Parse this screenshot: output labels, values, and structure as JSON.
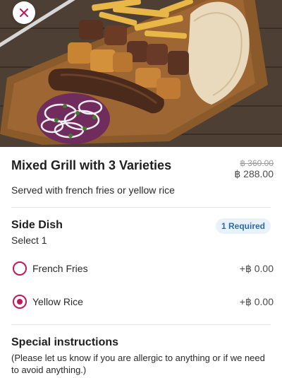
{
  "header": {
    "image_name": "mixed-grill-photo",
    "close_icon": "close-icon",
    "accent": "#c2185b"
  },
  "item": {
    "title": "Mixed Grill with 3 Varieties",
    "original_price": "฿ 360.00",
    "price": "฿ 288.00",
    "description": "Served with french fries or yellow rice"
  },
  "side_dish": {
    "title": "Side Dish",
    "badge": "1 Required",
    "instruction": "Select 1",
    "options": [
      {
        "label": "French Fries",
        "price": "+฿ 0.00",
        "selected": false
      },
      {
        "label": "Yellow Rice",
        "price": "+฿ 0.00",
        "selected": true
      }
    ]
  },
  "special_instructions": {
    "title": "Special instructions",
    "text": "(Please let us know if you are allergic to anything or if we need to avoid anything.)"
  }
}
